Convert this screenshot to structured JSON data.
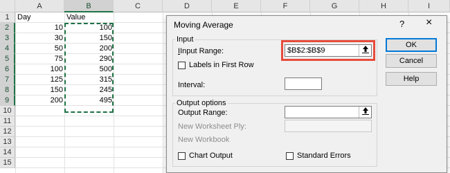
{
  "spreadsheet": {
    "columns": [
      "A",
      "B",
      "C",
      "D",
      "E",
      "F",
      "G",
      "H",
      "I"
    ],
    "rows": [
      "1",
      "2",
      "3",
      "4",
      "5",
      "6",
      "7",
      "8",
      "9",
      "10",
      "11",
      "12",
      "13",
      "14",
      "15"
    ],
    "headers": {
      "day": "Day",
      "value": "Value"
    },
    "data": [
      {
        "day": "10",
        "value": "100"
      },
      {
        "day": "30",
        "value": "150"
      },
      {
        "day": "50",
        "value": "200"
      },
      {
        "day": "75",
        "value": "290"
      },
      {
        "day": "100",
        "value": "500"
      },
      {
        "day": "125",
        "value": "315"
      },
      {
        "day": "150",
        "value": "245"
      },
      {
        "day": "200",
        "value": "495"
      }
    ],
    "selected_column": "B"
  },
  "dialog": {
    "title": "Moving Average",
    "help_glyph": "?",
    "close_glyph": "×",
    "input_group": "Input",
    "input_range_label": "Input Range:",
    "input_range_value": "$B$2:$B$9",
    "labels_first_row": "Labels in First Row",
    "interval_label": "Interval:",
    "interval_value": "",
    "output_group": "Output options",
    "output_range_label": "Output Range:",
    "output_range_value": "",
    "new_ply_label": "New Worksheet Ply:",
    "new_workbook_label": "New Workbook",
    "chart_output": "Chart Output",
    "standard_errors": "Standard Errors",
    "buttons": {
      "ok": "OK",
      "cancel": "Cancel",
      "help": "Help"
    }
  },
  "colors": {
    "accent": "#217346",
    "highlight": "#e74c3c",
    "default_button": "#0078d7"
  }
}
